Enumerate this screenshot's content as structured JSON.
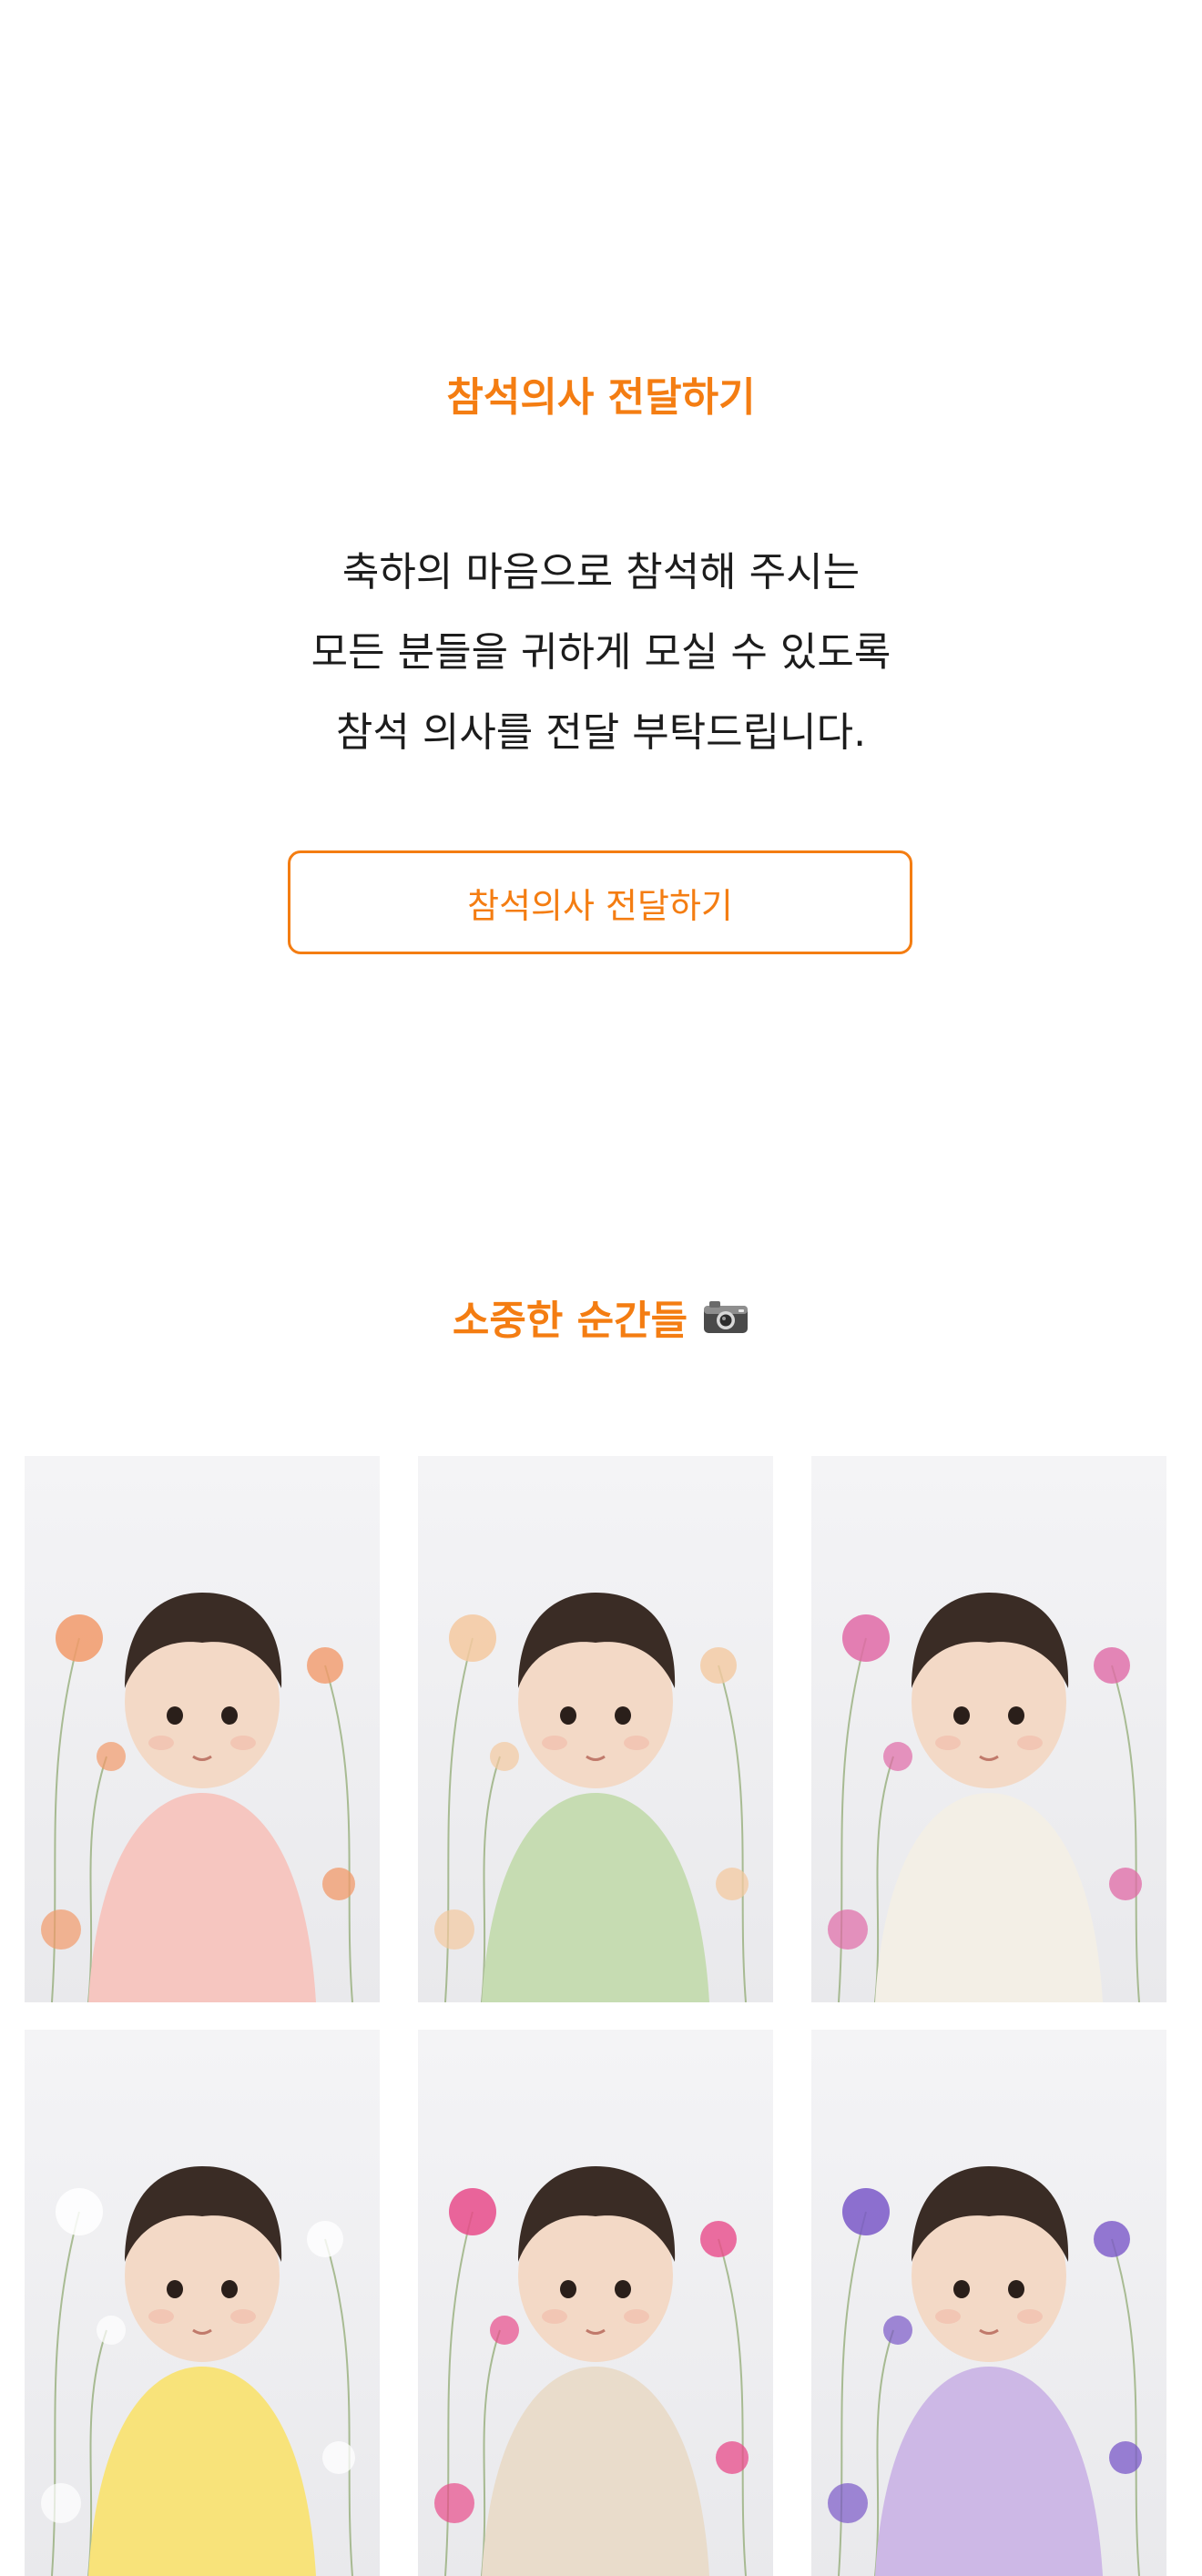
{
  "rsvp": {
    "title": "참석의사 전달하기",
    "lines": [
      "축하의 마음으로 참석해 주시는",
      "모든 분들을 귀하게 모실 수 있도록",
      "참석 의사를 전달 부탁드립니다."
    ],
    "button_label": "참석의사 전달하기"
  },
  "gallery": {
    "title": "소중한 순간들",
    "title_icon": "camera-icon",
    "photos": [
      {
        "outfit_color": "#f6c6c0",
        "flower_color": "#f29a6a"
      },
      {
        "outfit_color": "#c6dcb2",
        "flower_color": "#f4c9a0"
      },
      {
        "outfit_color": "#f3efe6",
        "flower_color": "#e06aa6"
      },
      {
        "outfit_color": "#f8e37a",
        "flower_color": "#ffffff"
      },
      {
        "outfit_color": "#e9dccb",
        "flower_color": "#e84b8a"
      },
      {
        "outfit_color": "#cdb8e6",
        "flower_color": "#7a58c8"
      }
    ]
  },
  "colors": {
    "accent": "#f47d12",
    "text": "#1c1c1c"
  }
}
